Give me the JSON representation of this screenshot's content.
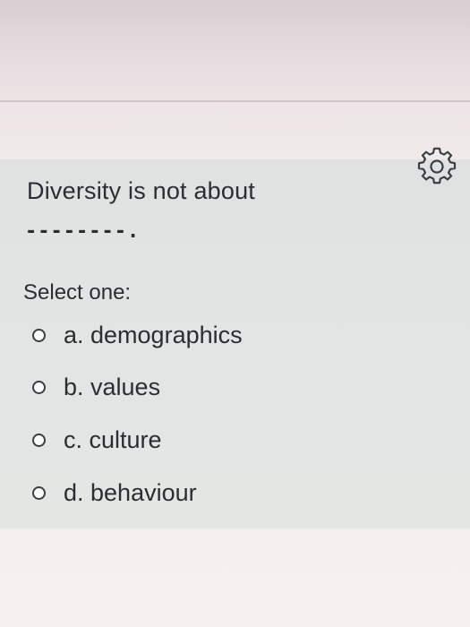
{
  "question": {
    "text": "Diversity is not about",
    "blank": "--------."
  },
  "answer": {
    "prompt": "Select one:",
    "options": [
      {
        "label": "a. demographics",
        "selected": false
      },
      {
        "label": "b. values",
        "selected": false
      },
      {
        "label": "c. culture",
        "selected": false
      },
      {
        "label": "d. behaviour",
        "selected": false
      }
    ]
  },
  "icons": {
    "settings": "gear-icon"
  }
}
